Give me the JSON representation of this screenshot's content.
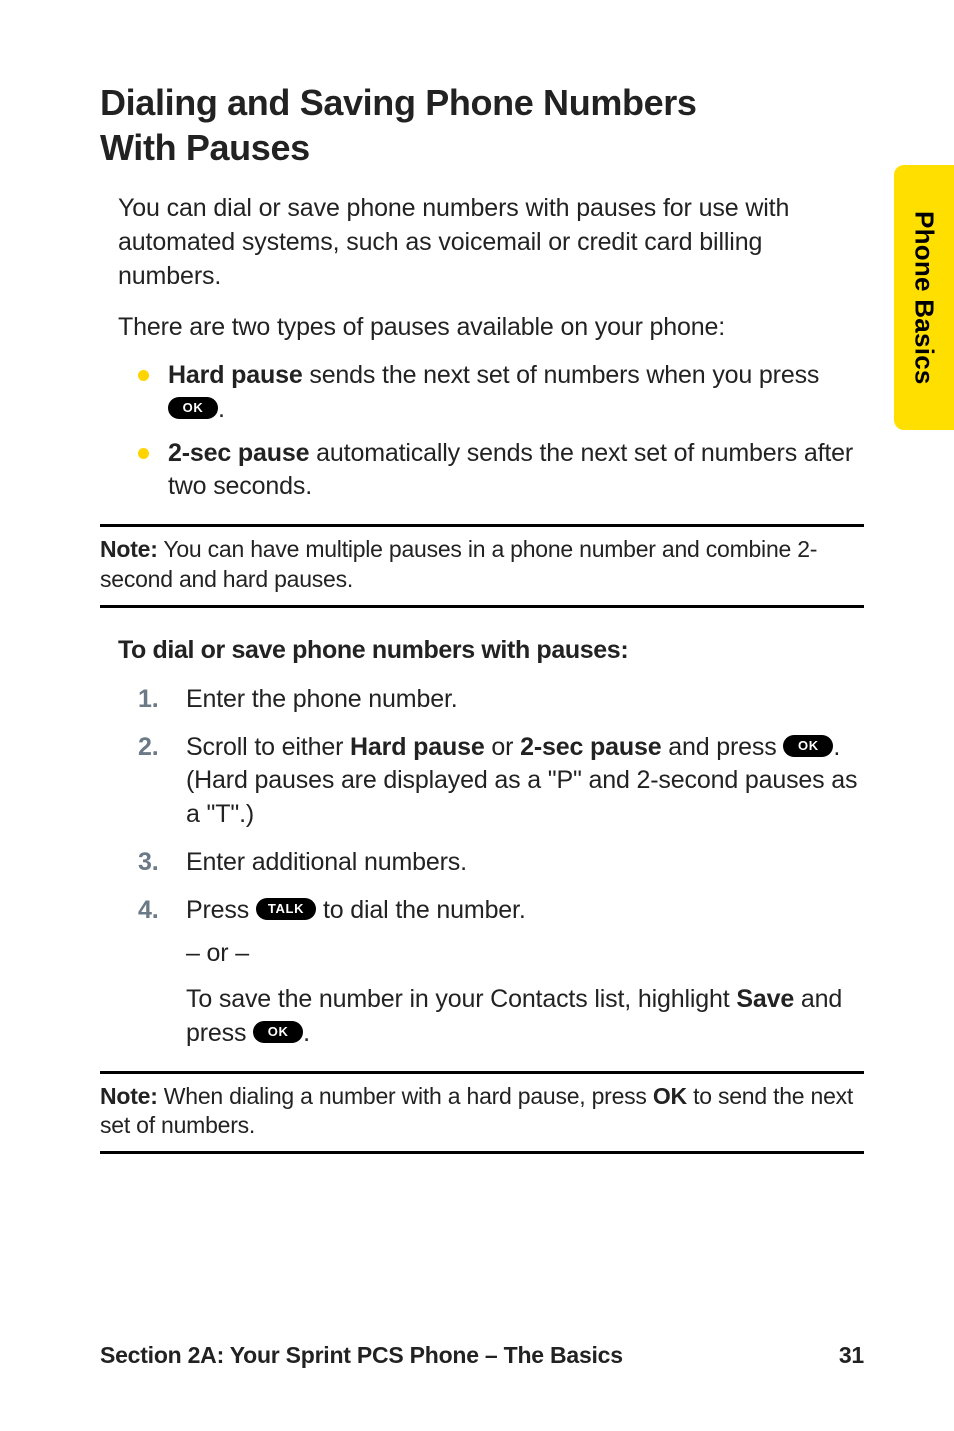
{
  "sideTab": "Phone Basics",
  "heading_l1": "Dialing and Saving Phone Numbers",
  "heading_l2": "With Pauses",
  "intro": "You can dial or save phone numbers with pauses for use with automated systems, such as voicemail or credit card billing numbers.",
  "intro2": "There are two types of pauses available on your phone:",
  "bullets": {
    "b1_strong": "Hard pause",
    "b1_rest": " sends the next set of numbers when you press ",
    "b1_period": ".",
    "b2_strong": "2-sec pause",
    "b2_rest": " automatically sends the next set of numbers after two seconds."
  },
  "keys": {
    "ok": "OK",
    "talk": "TALK"
  },
  "note1_label": "Note:",
  "note1_text": " You can have multiple pauses in a phone number and combine 2-second and hard pauses.",
  "subhead": "To dial or save phone numbers with pauses:",
  "steps": {
    "s1": "Enter the phone number.",
    "s2_a": "Scroll to either ",
    "s2_b": "Hard pause",
    "s2_c": " or ",
    "s2_d": "2-sec pause",
    "s2_e": " and press ",
    "s2_f": ". (Hard pauses are displayed as a \"P\" and 2-second pauses as a \"T\".)",
    "s3": "Enter additional numbers.",
    "s4_a": "Press ",
    "s4_b": " to dial the number.",
    "s4_or": "– or –",
    "s4_c": "To save the number in your Contacts list, highlight ",
    "s4_d": "Save",
    "s4_e": " and press ",
    "s4_f": "."
  },
  "note2_label": "Note:",
  "note2_a": " When dialing a number with a hard pause, press ",
  "note2_b": "OK",
  "note2_c": " to send the next set of numbers.",
  "footer_left": "Section 2A: Your Sprint PCS Phone – The Basics",
  "footer_page": "31"
}
